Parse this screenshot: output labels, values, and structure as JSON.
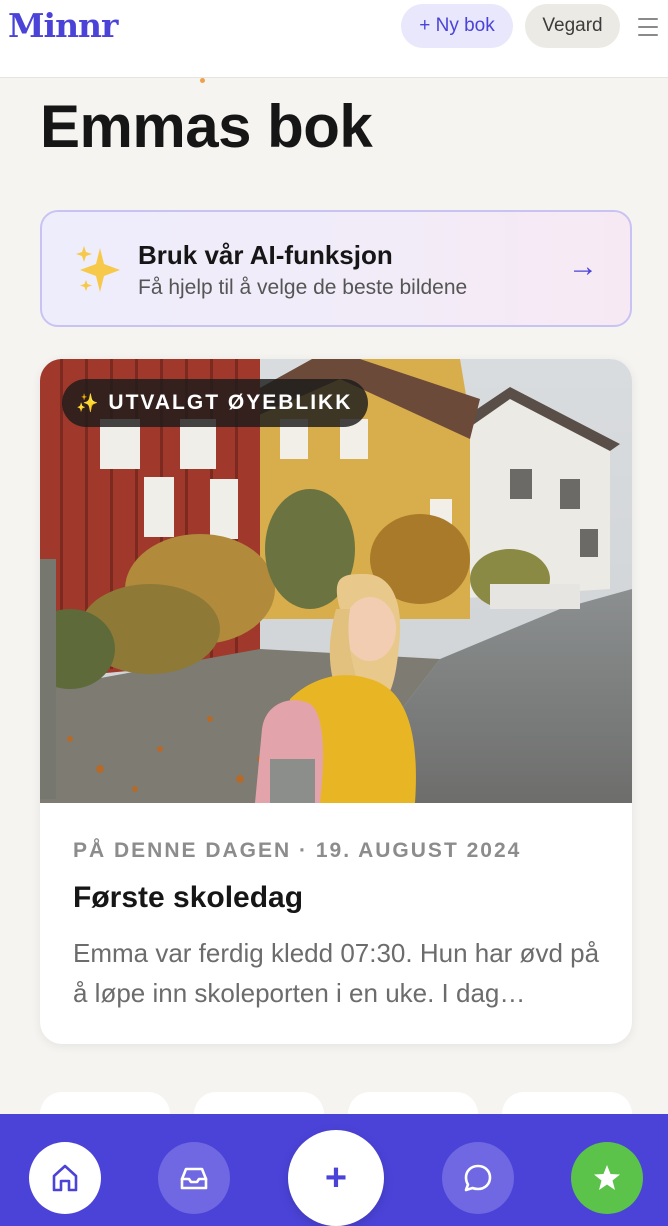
{
  "header": {
    "logo": "Minnr",
    "new_book_label": "+ Ny bok",
    "user_label": "Vegard"
  },
  "page": {
    "title": "Emmas bok"
  },
  "ai_banner": {
    "title": "Bruk vår AI-funksjon",
    "subtitle": "Få hjelp til å velge de beste bildene",
    "arrow": "→"
  },
  "memory": {
    "badge_icon": "✨",
    "badge": "UTVALGT ØYEBLIKK",
    "meta": "PÅ DENNE DAGEN · 19. AUGUST 2024",
    "title": "Første skoledag",
    "excerpt": "Emma var ferdig kledd 07:30. Hun har øvd på å løpe inn skoleporten i en uke. I dag…"
  },
  "bottom_nav": {
    "items": [
      {
        "icon": "home-icon"
      },
      {
        "icon": "inbox-icon"
      },
      {
        "icon": "plus-icon",
        "label": "+"
      },
      {
        "icon": "chat-icon"
      },
      {
        "icon": "star-icon"
      }
    ]
  },
  "colors": {
    "brand": "#4b43d8",
    "accent_green": "#5cc34a",
    "background": "#f5f4f1"
  }
}
